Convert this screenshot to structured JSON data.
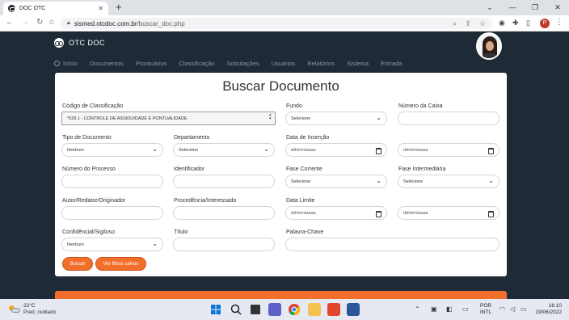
{
  "browser": {
    "tab_title": "DOC OTC",
    "tab_close": "✕",
    "new_tab": "+",
    "url_host": "sismed.otcdoc.com.br",
    "url_path": "/buscar_doc.php",
    "profile_initial": "P",
    "window_controls": [
      "⌄",
      "—",
      "❐",
      "✕"
    ]
  },
  "site": {
    "logo_text": "OTC DOC",
    "nav": [
      "Início",
      "Documentos",
      "Prontuários",
      "Classificação",
      "Solicitações",
      "Usuários",
      "Relatórios",
      "Sistema",
      "Entrada"
    ]
  },
  "form": {
    "title": "Buscar Documento",
    "labels": {
      "codigo": "Código de Classificação",
      "fundo": "Fundo",
      "numero_caixa": "Número da Caixa",
      "tipo": "Tipo de Documento",
      "departamento": "Departamento",
      "data_insercao": "Data de Inserção",
      "numero_processo": "Número do Processo",
      "identificador": "Identificador",
      "fase_corrente": "Fase Corrente",
      "fase_intermediaria": "Fase Intermediária",
      "autor": "Autor/Redator/Originador",
      "procedencia": "Procedência/Interessado",
      "data_limite": "Data Limite",
      "confidencial": "Confidêncial/Sigiloso",
      "titulo": "Título",
      "palavra_chave": "Palavra-Chave"
    },
    "values": {
      "codigo": "*029.1 - CONTROLE DE ASSIDUIDADE E PONTUALIDADE",
      "fundo": "Selecione",
      "tipo": "Nenhum",
      "departamento": "Selecione",
      "date_placeholder": "dd/mm/aaaa",
      "fase_corrente": "Selecione",
      "fase_intermediaria": "Selecione",
      "confidencial": "Nenhum"
    },
    "buttons": {
      "buscar": "Buscar",
      "filtros": "Ver filtros salvos"
    }
  },
  "taskbar": {
    "temp": "22°C",
    "weather": "Pred. nublado",
    "lang1": "POR",
    "lang2": "INTL",
    "time": "16:10",
    "date": "19/06/2022"
  },
  "colors": {
    "header_bg": "#1e2a36",
    "accent": "#f26f2b"
  }
}
